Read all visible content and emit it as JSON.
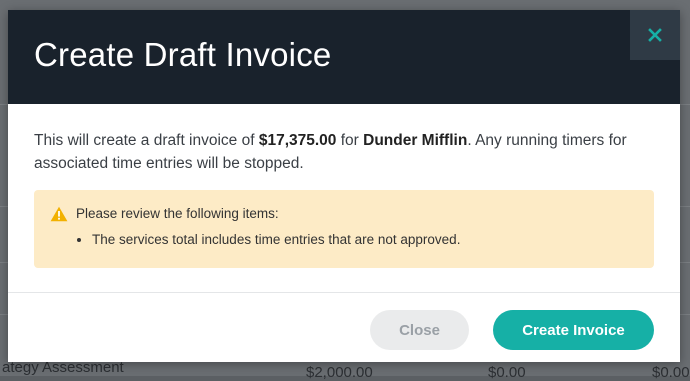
{
  "modal": {
    "title": "Create Draft Invoice",
    "message_prefix": "This will create a draft invoice of ",
    "amount": "$17,375.00",
    "message_middle": " for ",
    "client": "Dunder Mifflin",
    "message_suffix": ". Any running timers for associated time entries will be stopped.",
    "warning": {
      "heading": "Please review the following items:",
      "items": [
        "The services total includes time entries that are not approved."
      ]
    },
    "buttons": {
      "close": "Close",
      "create": "Create Invoice"
    }
  },
  "background": {
    "row_label": "ategy Assessment",
    "amount": "$2,000.00",
    "zero": "$0.00"
  },
  "colors": {
    "header": "#19222c",
    "accent": "#16b0a6",
    "warning_bg": "#fdebc6",
    "warning_icon": "#f2b100",
    "close_icon": "#16b0a6"
  }
}
